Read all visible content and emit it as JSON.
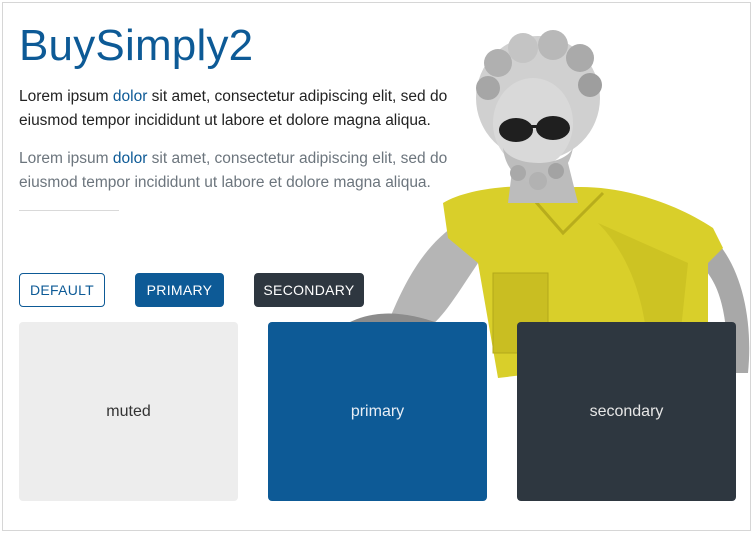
{
  "hero": {
    "title": "BuySimply2",
    "para1": {
      "before": "Lorem ipsum ",
      "link": "dolor",
      "after": " sit amet, consectetur adipiscing elit, sed do eiusmod tempor incididunt ut labore et dolore magna aliqua."
    },
    "para2": {
      "before": "Lorem ipsum ",
      "link": "dolor",
      "after": " sit amet, consectetur adipiscing elit, sed do eiusmod tempor incididunt ut labore et dolore magna aliqua."
    }
  },
  "buttons": {
    "default_label": "DEFAULT",
    "primary_label": "PRIMARY",
    "secondary_label": "SECONDARY"
  },
  "tiles": {
    "muted": "muted",
    "primary": "primary",
    "secondary": "secondary"
  },
  "colors": {
    "primary": "#0d5a96",
    "secondary": "#2e3740",
    "muted": "#ededed",
    "shirt": "#d9cf2a"
  },
  "image": {
    "icon": "statue-with-sunglasses-yellow-shirt-image"
  }
}
